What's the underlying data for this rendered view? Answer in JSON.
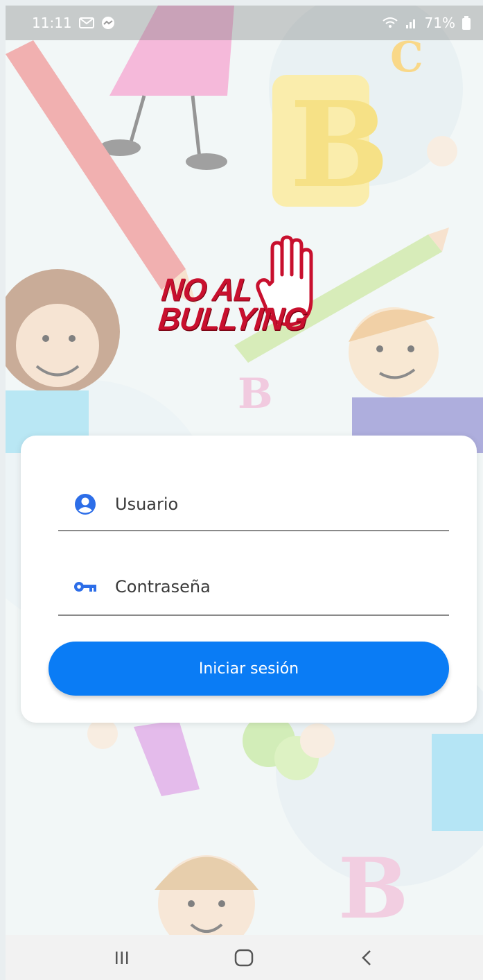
{
  "status_bar": {
    "time": "11:11",
    "battery": "71%",
    "icons": [
      "gmail-icon",
      "messenger-icon",
      "wifi-icon",
      "signal-icon",
      "battery-icon"
    ]
  },
  "logo": {
    "line1": "NO AL",
    "line2": "BULLYING",
    "icon": "stop-hand-icon",
    "color": "#c8102e"
  },
  "login": {
    "username_placeholder": "Usuario",
    "password_placeholder": "Contraseña",
    "username_icon": "account-circle-icon",
    "password_icon": "key-icon",
    "submit_label": "Iniciar sesión",
    "accent_color": "#0a7cf5"
  },
  "nav_bar": {
    "buttons": [
      "recents-icon",
      "home-icon",
      "back-icon"
    ]
  }
}
